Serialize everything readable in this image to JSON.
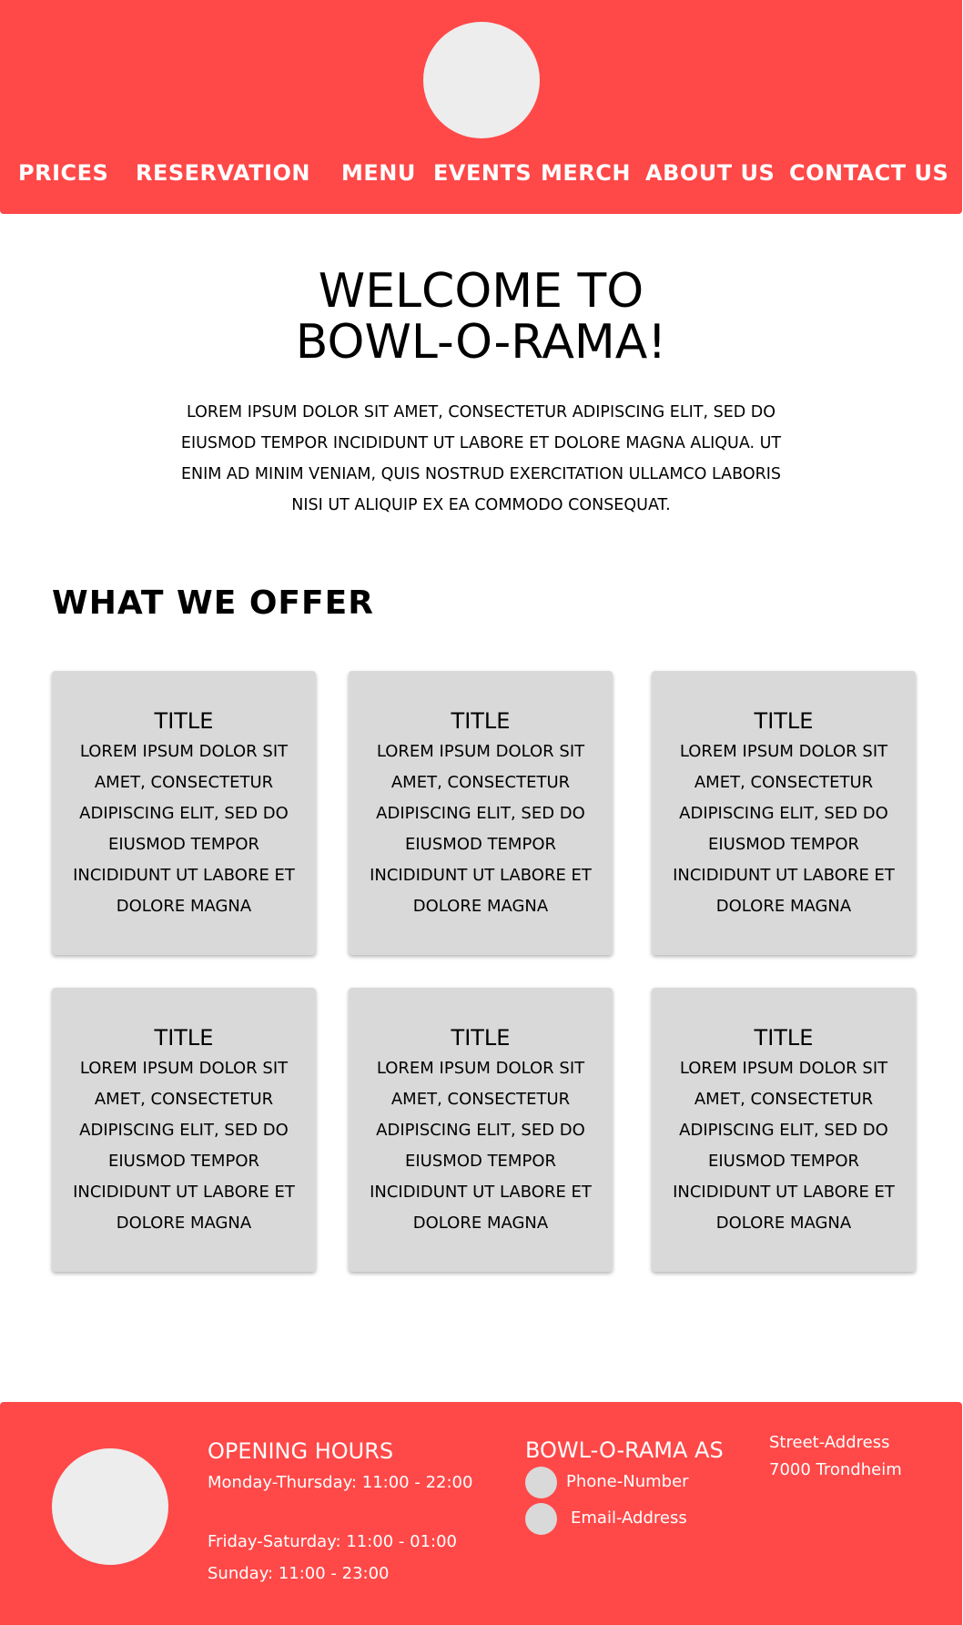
{
  "colors": {
    "accent": "#ff4848",
    "circle": "#ededed",
    "contact_circle": "#d9d9d9",
    "card": "#d9d9d9"
  },
  "header": {
    "logo_icon": "logo-circle",
    "nav": [
      "PRICES",
      "RESERVATION",
      "MENU",
      "EVENTS",
      "MERCH",
      "ABOUT US",
      "CONTACT US"
    ]
  },
  "welcome": {
    "title_line1": "WELCOME TO",
    "title_line2": "BOWL-O-RAMA!",
    "text": "LOREM IPSUM DOLOR SIT AMET, CONSECTETUR ADIPISCING ELIT, SED DO EIUSMOD TEMPOR INCIDIDUNT UT LABORE ET DOLORE MAGNA ALIQUA. UT ENIM AD MINIM VENIAM, QUIS NOSTRUD EXERCITATION ULLAMCO LABORIS NISI UT ALIQUIP EX EA COMMODO CONSEQUAT."
  },
  "offer": {
    "heading": "WHAT WE OFFER",
    "cards": [
      {
        "title": "TITLE",
        "text": "LOREM IPSUM DOLOR SIT AMET, CONSECTETUR ADIPISCING ELIT, SED DO EIUSMOD TEMPOR INCIDIDUNT UT LABORE ET DOLORE MAGNA"
      },
      {
        "title": "TITLE",
        "text": "LOREM IPSUM DOLOR SIT AMET, CONSECTETUR ADIPISCING ELIT, SED DO EIUSMOD TEMPOR INCIDIDUNT UT LABORE ET DOLORE MAGNA"
      },
      {
        "title": "TITLE",
        "text": "LOREM IPSUM DOLOR SIT AMET, CONSECTETUR ADIPISCING ELIT, SED DO EIUSMOD TEMPOR INCIDIDUNT UT LABORE ET DOLORE MAGNA"
      },
      {
        "title": "TITLE",
        "text": "LOREM IPSUM DOLOR SIT AMET, CONSECTETUR ADIPISCING ELIT, SED DO EIUSMOD TEMPOR INCIDIDUNT UT LABORE ET DOLORE MAGNA"
      },
      {
        "title": "TITLE",
        "text": "LOREM IPSUM DOLOR SIT AMET, CONSECTETUR ADIPISCING ELIT, SED DO EIUSMOD TEMPOR INCIDIDUNT UT LABORE ET DOLORE MAGNA"
      },
      {
        "title": "TITLE",
        "text": "LOREM IPSUM DOLOR SIT AMET, CONSECTETUR ADIPISCING ELIT, SED DO EIUSMOD TEMPOR INCIDIDUNT UT LABORE ET DOLORE MAGNA"
      }
    ]
  },
  "footer": {
    "logo_icon": "logo-circle",
    "hours_title": "OPENING HOURS",
    "hours": [
      "Monday-Thursday: 11:00 - 22:00",
      "Friday-Saturday: 11:00 - 01:00",
      "Sunday: 11:00 - 23:00"
    ],
    "company": "BOWL-O-RAMA AS",
    "phone": "Phone-Number",
    "email": "Email-Address",
    "phone_icon": "phone-circle-icon",
    "email_icon": "email-circle-icon",
    "address_street": "Street-Address",
    "address_city": "7000 Trondheim"
  }
}
